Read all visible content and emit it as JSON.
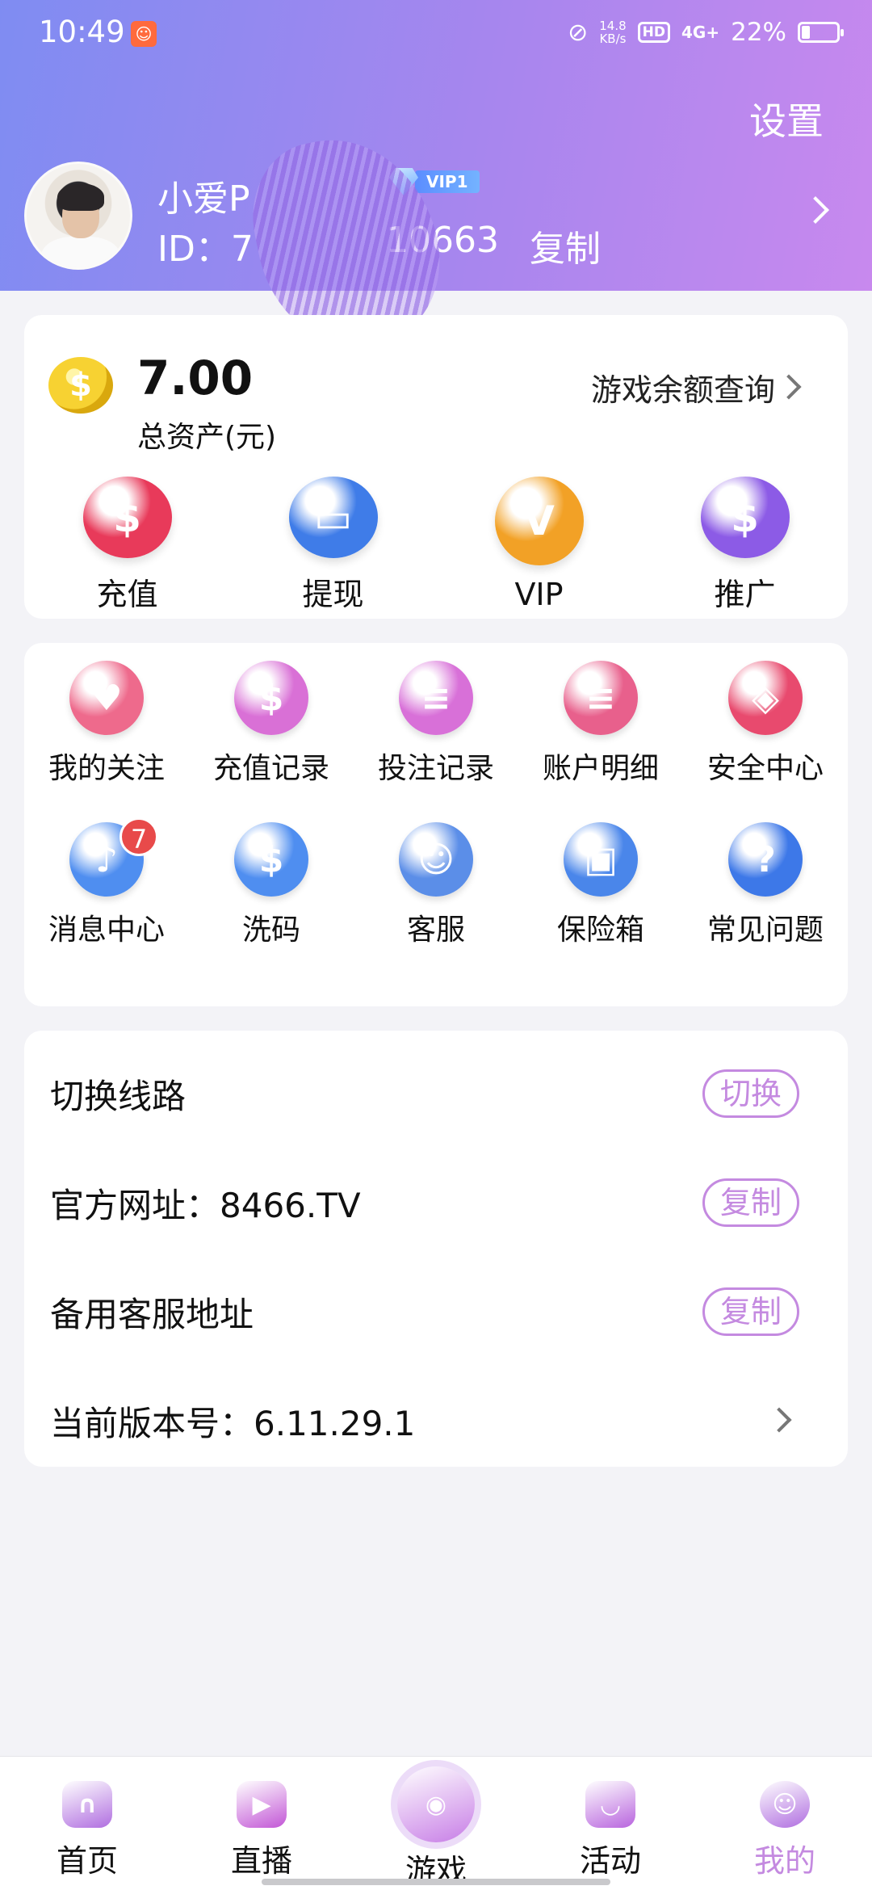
{
  "status_bar": {
    "time": "10:49",
    "speed": "14.8",
    "speed_unit": "KB/s",
    "hd": "HD",
    "network": "4G+",
    "battery": "22%",
    "battery_level": 0.22
  },
  "header": {
    "settings": "设置",
    "user_name": "小爱P",
    "vip_tag": "VIP1",
    "user_id_prefix": "ID：7",
    "user_id_suffix": "10663",
    "copy_label": "复制"
  },
  "assets": {
    "amount": "7.00",
    "label": "总资产(元)",
    "coin_symbol": "$",
    "balance_query": "游戏余额查询",
    "actions": [
      {
        "label": "充值",
        "icon": "money-bag-icon",
        "symbol": "$",
        "color": "#e83a5a"
      },
      {
        "label": "提现",
        "icon": "card-icon",
        "symbol": "▭",
        "color": "#3f7ce8"
      },
      {
        "label": "VIP",
        "icon": "vip-icon",
        "symbol": "V",
        "color": "#f2a126"
      },
      {
        "label": "推广",
        "icon": "promote-bag-icon",
        "symbol": "$",
        "color": "#8c5be6"
      }
    ]
  },
  "services": [
    {
      "label": "我的关注",
      "icon": "heart-plus-icon",
      "symbol": "♥",
      "color": "#ee6a8c"
    },
    {
      "label": "充值记录",
      "icon": "recharge-record-icon",
      "symbol": "$",
      "color": "#d970d6"
    },
    {
      "label": "投注记录",
      "icon": "bet-record-icon",
      "symbol": "≡",
      "color": "#d870d8"
    },
    {
      "label": "账户明细",
      "icon": "account-detail-icon",
      "symbol": "≡",
      "color": "#e8608c"
    },
    {
      "label": "安全中心",
      "icon": "security-icon",
      "symbol": "◈",
      "color": "#e84a6e"
    },
    {
      "label": "消息中心",
      "icon": "bell-icon",
      "symbol": "♪",
      "color": "#4f8ef0",
      "badge": "7"
    },
    {
      "label": "洗码",
      "icon": "chip-icon",
      "symbol": "$",
      "color": "#4f8ef0"
    },
    {
      "label": "客服",
      "icon": "headset-icon",
      "symbol": "☺",
      "color": "#5b8ee8"
    },
    {
      "label": "保险箱",
      "icon": "safe-icon",
      "symbol": "▣",
      "color": "#4a86ea"
    },
    {
      "label": "常见问题",
      "icon": "question-icon",
      "symbol": "?",
      "color": "#3d78e8"
    }
  ],
  "settings_rows": [
    {
      "label": "切换线路",
      "button": "切换"
    },
    {
      "label": "官方网址：8466.TV",
      "button": "复制"
    },
    {
      "label": "备用客服地址",
      "button": "复制"
    },
    {
      "label": "当前版本号：6.11.29.1"
    }
  ],
  "bottom_nav": [
    {
      "label": "首页",
      "icon": "home-icon",
      "symbol": "∩",
      "color": "#b06ee0"
    },
    {
      "label": "直播",
      "icon": "live-video-icon",
      "symbol": "▶",
      "color": "#c256d6"
    },
    {
      "label": "游戏",
      "icon": "gamepad-icon",
      "symbol": "◉",
      "color": "#c77de6",
      "center": true
    },
    {
      "label": "活动",
      "icon": "activity-icon",
      "symbol": "◡",
      "color": "#b864de"
    },
    {
      "label": "我的",
      "icon": "profile-smile-icon",
      "symbol": "☺",
      "color": "#b06ee0",
      "active": true
    }
  ],
  "accent_color": "#c48ae0"
}
